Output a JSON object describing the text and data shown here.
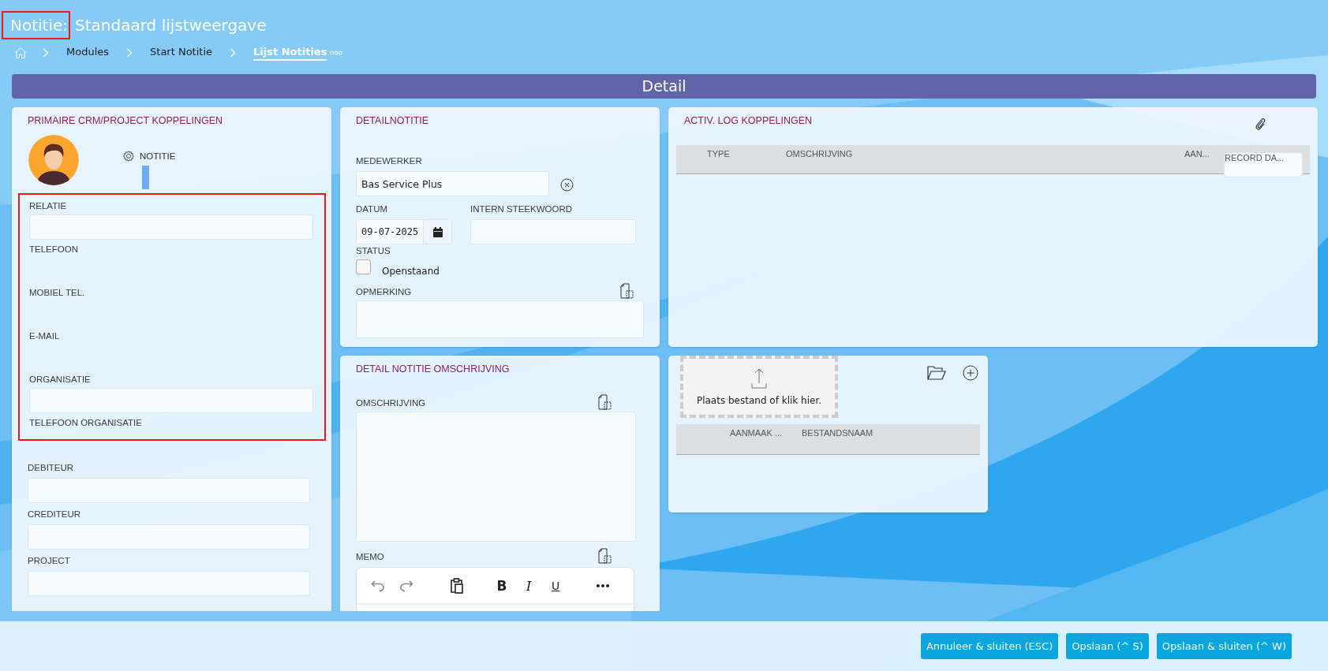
{
  "title": {
    "module": "Notitie:",
    "view": "Standaard lijstweergave",
    "module_highlighted": true
  },
  "breadcrumb": [
    {
      "label": "Modules",
      "selected": false
    },
    {
      "label": "Start Notitie",
      "selected": false
    },
    {
      "label": "Lijst Notities",
      "selected": true
    }
  ],
  "section_bar": "Detail",
  "crm_card": {
    "heading": "PRIMAIRE CRM/PROJECT KOPPELINGEN",
    "tab_label": "NOTITIE",
    "group_highlighted": true,
    "group_fields": [
      {
        "label": "RELATIE",
        "kind": "input"
      },
      {
        "label": "TELEFOON",
        "kind": "text"
      },
      {
        "label": "MOBIEL TEL.",
        "kind": "text"
      },
      {
        "label": "E-MAIL",
        "kind": "text"
      },
      {
        "label": "ORGANISATIE",
        "kind": "input"
      },
      {
        "label": "TELEFOON ORGANISATIE",
        "kind": "text"
      }
    ],
    "fields": [
      {
        "label": "DEBITEUR",
        "kind": "input"
      },
      {
        "label": "CREDITEUR",
        "kind": "input"
      },
      {
        "label": "PROJECT",
        "kind": "input"
      }
    ]
  },
  "detail_card": {
    "heading": "DETAILNOTITIE",
    "employee": {
      "label": "MEDEWERKER",
      "value": "Bas Service Plus"
    },
    "date": {
      "label": "DATUM",
      "value": "09-07-2025"
    },
    "keyword": {
      "label": "INTERN STEEKWOORD"
    },
    "status": {
      "label": "STATUS",
      "option": "Openstaand",
      "checked": false
    },
    "remark": {
      "label": "OPMERKING"
    }
  },
  "description_card": {
    "heading": "DETAIL NOTITIE OMSCHRIJVING",
    "description_label": "OMSCHRIJVING",
    "memo_label": "MEMO",
    "format_buttons": [
      {
        "label": "B",
        "kind": "bold"
      },
      {
        "label": "I",
        "kind": "italic"
      },
      {
        "label": "U",
        "kind": "underline"
      }
    ]
  },
  "activity_card": {
    "heading": "ACTIV. LOG KOPPELINGEN",
    "columns": [
      {
        "label": "TYPE",
        "kind": "type"
      },
      {
        "label": "OMSCHRIJVING",
        "kind": "description"
      },
      {
        "label": "AAN...",
        "kind": "count"
      },
      {
        "label": "RECORD DA...",
        "kind": "date"
      }
    ]
  },
  "files_card": {
    "dropzone": "Plaats bestand of klik hier.",
    "columns": [
      "AANMAAK ...",
      "BESTANDSNAAM"
    ]
  },
  "buttons": [
    "Annuleer & sluiten (ESC)",
    "Opslaan (^ S)",
    "Opslaan & sluiten (^ W)"
  ]
}
